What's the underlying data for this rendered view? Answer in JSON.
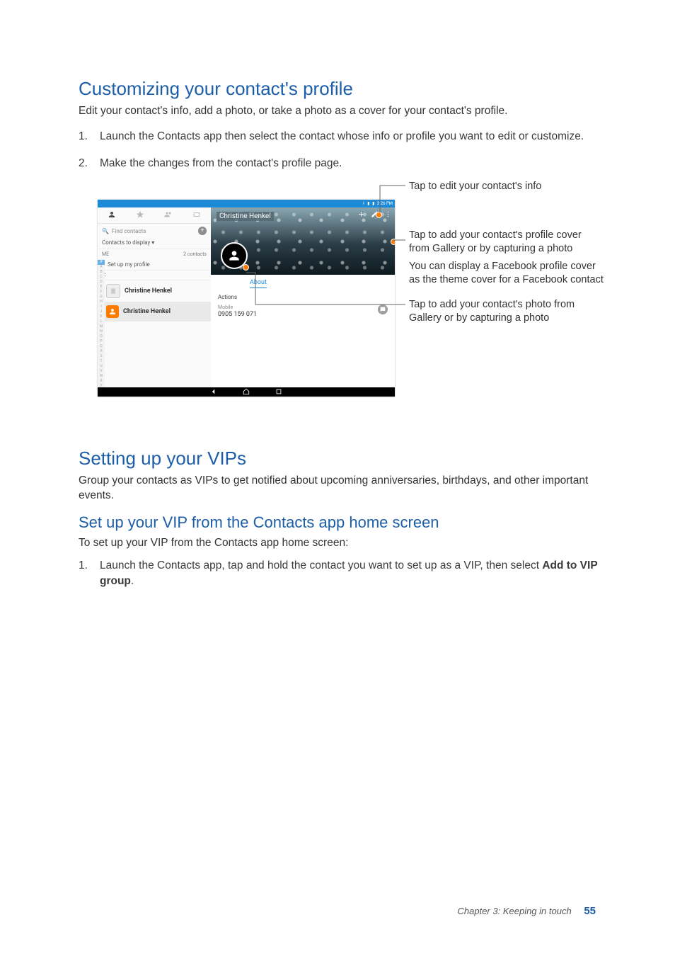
{
  "headings": {
    "customizing": "Customizing your contact's profile",
    "vips": "Setting up your VIPs",
    "vip_sub": "Set up your VIP from the Contacts app home screen"
  },
  "paragraphs": {
    "customizing_intro": "Edit your contact's info, add a photo, or take a photo as a cover for your contact's profile.",
    "vips_intro": "Group your contacts as VIPs to get notified about upcoming anniversaries, birthdays, and other important events.",
    "vip_sub_intro": "To set up your VIP from the Contacts app home screen:"
  },
  "steps_customize": [
    "Launch the Contacts app then select the contact whose info or profile you want to edit or customize.",
    "Make the changes from the contact's profile page."
  ],
  "steps_vip": {
    "pre": "Launch the Contacts app, tap and hold the contact you want to set up as a VIP, then select ",
    "bold": "Add to VIP group",
    "post": "."
  },
  "shot": {
    "status_time": "3:26 PM",
    "search_placeholder": "Find contacts",
    "contacts_to_display": "Contacts to display ▾",
    "me_label": "ME",
    "contacts_count": "2 contacts",
    "set_up_profile": "Set up my profile",
    "c_header": "C",
    "contact_name": "Christine Henkel",
    "name_header": "Christine Henkel",
    "tab_actions": "Actions",
    "tab_about": "About",
    "mobile_label": "Mobile",
    "mobile_value": "0905 159 071"
  },
  "callouts": {
    "edit": "Tap to edit your contact's info",
    "cover1": "Tap to add your contact's profile cover from Gallery or by capturing a photo",
    "cover2": "You can display a Facebook profile cover as the theme cover for a Facebook contact",
    "photo": "Tap to add your contact's photo from Gallery or by capturing a photo"
  },
  "footer": {
    "chapter": "Chapter 3: Keeping in touch",
    "page": "55"
  },
  "alpha": [
    "#",
    "A",
    "B",
    "C",
    "D",
    "E",
    "F",
    "G",
    "H",
    "I",
    "J",
    "K",
    "L",
    "M",
    "N",
    "O",
    "P",
    "Q",
    "R",
    "S",
    "T",
    "U",
    "V",
    "W",
    "X",
    "Y",
    "Z"
  ]
}
